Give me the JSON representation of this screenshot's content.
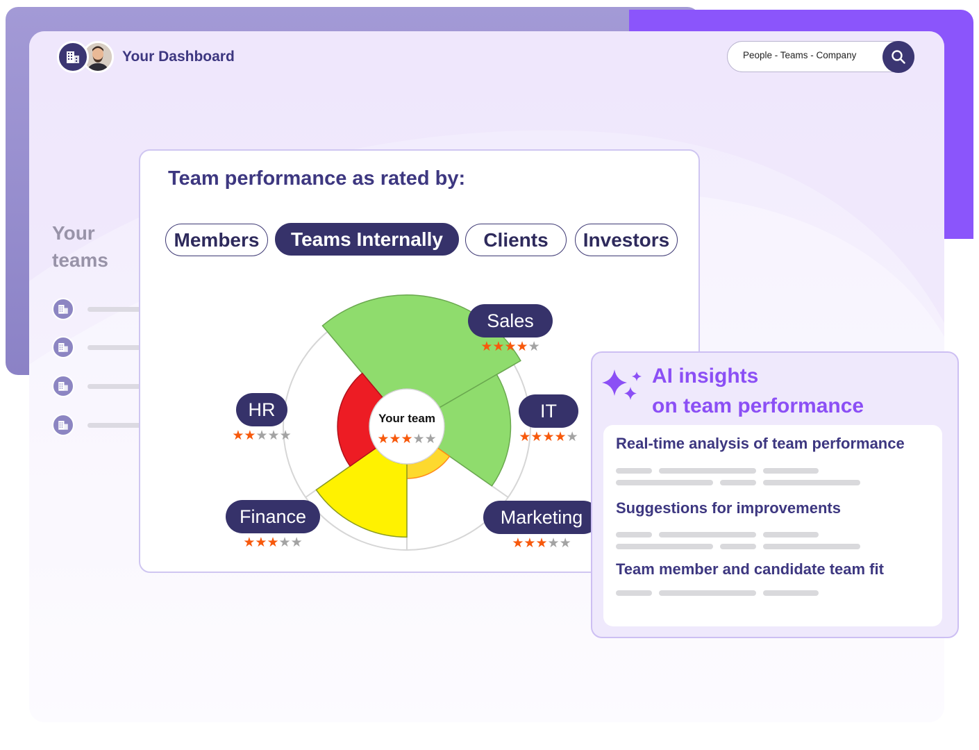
{
  "header": {
    "title": "Your Dashboard",
    "search": {
      "placeholder": "People - Teams - Company"
    }
  },
  "sidebar": {
    "heading": "Your teams",
    "items": [
      {
        "icon": "building-icon"
      },
      {
        "icon": "building-icon"
      },
      {
        "icon": "building-icon"
      },
      {
        "icon": "building-icon"
      }
    ]
  },
  "performance": {
    "title": "Team performance as rated by:",
    "tabs": [
      {
        "label": "Members",
        "active": false
      },
      {
        "label": "Teams Internally",
        "active": true
      },
      {
        "label": "Clients",
        "active": false
      },
      {
        "label": "Investors",
        "active": false
      }
    ]
  },
  "chart_data": {
    "type": "polar-area",
    "center": {
      "label": "Your team",
      "rating": 3,
      "max": 5
    },
    "segments": [
      {
        "name": "Sales",
        "rating": 4,
        "max": 5,
        "color": "#8fdc6d"
      },
      {
        "name": "IT",
        "rating": 4,
        "max": 5,
        "color": "#8fdc6d"
      },
      {
        "name": "Marketing",
        "rating": 3,
        "max": 5,
        "color": "#fdd92e"
      },
      {
        "name": "Finance",
        "rating": 3,
        "max": 5,
        "color": "#fff200"
      },
      {
        "name": "HR",
        "rating": 2,
        "max": 5,
        "color": "#ed1c24"
      }
    ],
    "colors": {
      "star_filled": "#f7590c",
      "star_empty": "#a3a3a3",
      "label_bg": "#36326a"
    }
  },
  "ai": {
    "title_line1": "AI insights",
    "title_line2": "on team performance",
    "items": [
      {
        "label": "Real-time analysis of team performance"
      },
      {
        "label": "Suggestions for improvements"
      },
      {
        "label": "Team member and candidate team fit"
      }
    ]
  },
  "colors": {
    "brand_dark": "#3b3672",
    "accent": "#8b55fb",
    "title": "#3d3780"
  }
}
